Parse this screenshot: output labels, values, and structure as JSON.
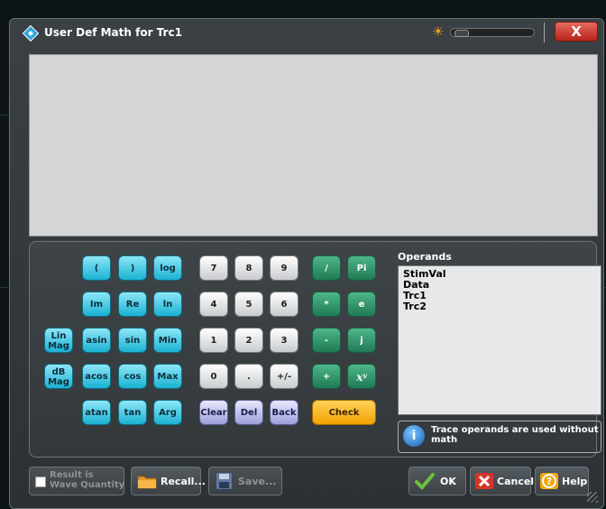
{
  "dialog": {
    "title": "User Def Math for Trc1",
    "close_symbol": "X"
  },
  "keys": {
    "lparen": "(",
    "rparen": ")",
    "log": "log",
    "im": "Im",
    "re": "Re",
    "ln": "ln",
    "linmag": "Lin\nMag",
    "asin": "asin",
    "sin": "sin",
    "min": "Min",
    "dbmag": "dB\nMag",
    "acos": "acos",
    "cos": "cos",
    "max": "Max",
    "atan": "atan",
    "tan": "tan",
    "arg": "Arg",
    "n7": "7",
    "n8": "8",
    "n9": "9",
    "n4": "4",
    "n5": "5",
    "n6": "6",
    "n1": "1",
    "n2": "2",
    "n3": "3",
    "n0": "0",
    "dot": ".",
    "plusminus": "+/-",
    "clear": "Clear",
    "del": "Del",
    "back": "Back",
    "divide": "/",
    "multiply": "*",
    "minus": "-",
    "plus": "+",
    "pi": "Pi",
    "e": "e",
    "j": "j",
    "power": "xʸ",
    "check": "Check"
  },
  "operands": {
    "label": "Operands",
    "items": [
      "StimVal",
      "Data",
      "Trc1",
      "Trc2"
    ],
    "info_text": "Trace operands are used without math",
    "info_symbol": "i"
  },
  "bottom": {
    "result_checkbox": "Result is\nWave Quantity",
    "recall": "Recall...",
    "save": "Save...",
    "ok": "OK",
    "cancel": "Cancel",
    "help": "Help"
  },
  "colors": {
    "key_cyan": "#1bb2d3",
    "key_grey": "#c9ccce",
    "key_green": "#1f7a55",
    "key_purple": "#9d9fd8",
    "key_orange": "#f2a100",
    "close_red": "#b8241a"
  },
  "icons": [
    "app-icon",
    "brightness-icon",
    "close-icon",
    "info-icon",
    "folder-icon",
    "disk-icon",
    "checkmark-icon",
    "cancel-icon",
    "help-icon",
    "resize-grip-icon"
  ]
}
